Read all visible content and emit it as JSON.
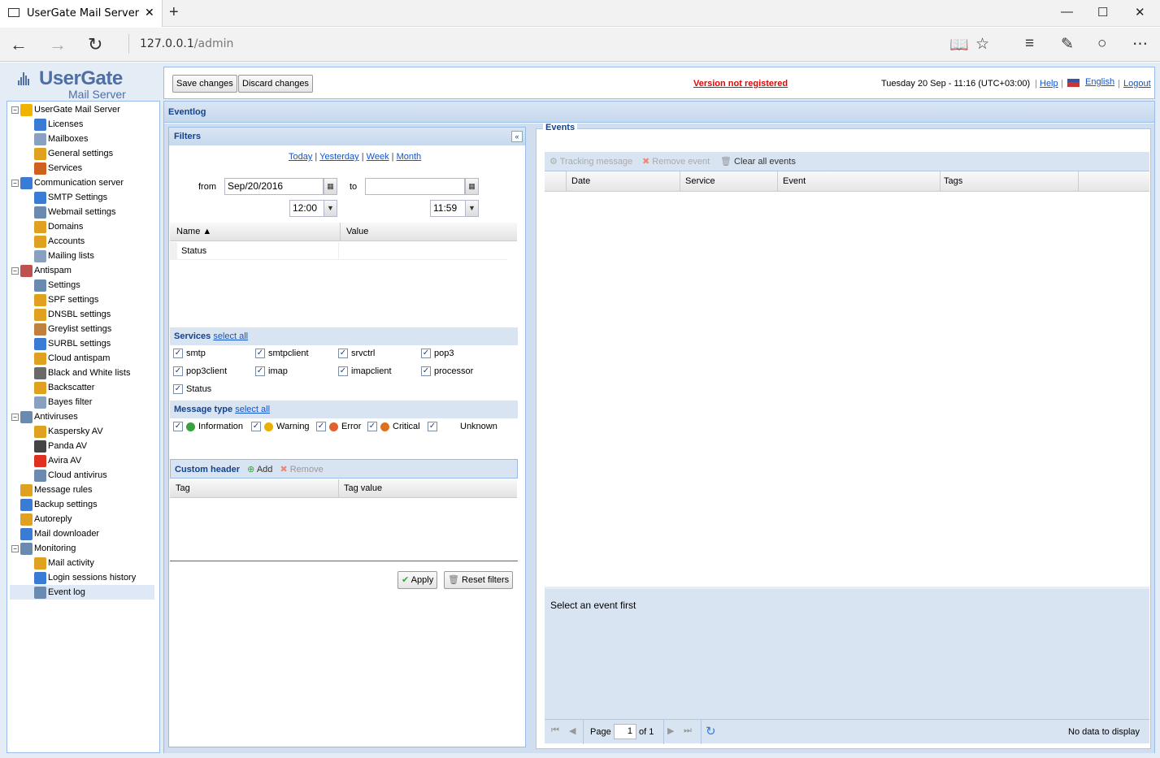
{
  "browser": {
    "tab_title": "UserGate Mail Server",
    "url_host": "127.0.0.1",
    "url_path": "/admin",
    "new_tab": "+",
    "minimize": "—",
    "maximize": "☐",
    "close": "✕"
  },
  "logo": {
    "brand": "UserGate",
    "product": "Mail Server"
  },
  "toolbar": {
    "save_label": "Save changes",
    "discard_label": "Discard changes",
    "not_registered": "Version not registered",
    "datetime": "Tuesday 20 Sep - 11:16 (UTC+03:00)",
    "help": "Help",
    "language": "English",
    "logout": "Logout",
    "sep": "|"
  },
  "tree": {
    "items": [
      {
        "label": "UserGate Mail Server",
        "icon": "server-icon",
        "color": "#f0b400"
      },
      {
        "label": "Licenses",
        "icon": "info-icon",
        "color": "#3a7bd5"
      },
      {
        "label": "Mailboxes",
        "icon": "mailbox-icon",
        "color": "#8aa0c0"
      },
      {
        "label": "General settings",
        "icon": "settings-icon",
        "color": "#e0a020"
      },
      {
        "label": "Services",
        "icon": "gears-icon",
        "color": "#d06020"
      },
      {
        "label": "Communication server",
        "icon": "at-icon",
        "color": "#3a7bd5"
      },
      {
        "label": "SMTP Settings",
        "icon": "at-icon",
        "color": "#3a7bd5"
      },
      {
        "label": "Webmail settings",
        "icon": "web-icon",
        "color": "#6a8ab0"
      },
      {
        "label": "Domains",
        "icon": "home-icon",
        "color": "#e0a020"
      },
      {
        "label": "Accounts",
        "icon": "users-icon",
        "color": "#e0a020"
      },
      {
        "label": "Mailing lists",
        "icon": "list-icon",
        "color": "#8aa0c0"
      },
      {
        "label": "Antispam",
        "icon": "antispam-icon",
        "color": "#c05050"
      },
      {
        "label": "Settings",
        "icon": "tools-icon",
        "color": "#6a8ab0"
      },
      {
        "label": "SPF settings",
        "icon": "spf-icon",
        "color": "#e0a020"
      },
      {
        "label": "DNSBL settings",
        "icon": "globe-icon",
        "color": "#e0a020"
      },
      {
        "label": "Greylist settings",
        "icon": "greylist-icon",
        "color": "#c08040"
      },
      {
        "label": "SURBL settings",
        "icon": "surbl-icon",
        "color": "#3a7bd5"
      },
      {
        "label": "Cloud antispam",
        "icon": "cloud-mail-icon",
        "color": "#e0a020"
      },
      {
        "label": "Black and White lists",
        "icon": "bw-list-icon",
        "color": "#6a6a6a"
      },
      {
        "label": "Backscatter",
        "icon": "backscatter-icon",
        "color": "#e0a020"
      },
      {
        "label": "Bayes filter",
        "icon": "bayes-icon",
        "color": "#8aa0c0"
      },
      {
        "label": "Antiviruses",
        "icon": "antivirus-icon",
        "color": "#6a8ab0"
      },
      {
        "label": "Kaspersky AV",
        "icon": "kaspersky-icon",
        "color": "#e0a020"
      },
      {
        "label": "Panda AV",
        "icon": "panda-icon",
        "color": "#444444"
      },
      {
        "label": "Avira AV",
        "icon": "avira-icon",
        "color": "#e03020"
      },
      {
        "label": "Cloud antivirus",
        "icon": "cloud-av-icon",
        "color": "#6a8ab0"
      },
      {
        "label": "Message rules",
        "icon": "rules-icon",
        "color": "#e0a020"
      },
      {
        "label": "Backup settings",
        "icon": "backup-icon",
        "color": "#3a7bd5"
      },
      {
        "label": "Autoreply",
        "icon": "autoreply-icon",
        "color": "#e0a020"
      },
      {
        "label": "Mail downloader",
        "icon": "downloader-icon",
        "color": "#3a7bd5"
      },
      {
        "label": "Monitoring",
        "icon": "monitoring-icon",
        "color": "#6a8ab0"
      },
      {
        "label": "Mail activity",
        "icon": "activity-icon",
        "color": "#e0a020"
      },
      {
        "label": "Login sessions history",
        "icon": "history-icon",
        "color": "#3a7bd5"
      },
      {
        "label": "Event log",
        "icon": "eventlog-icon",
        "color": "#6a8ab0"
      }
    ]
  },
  "eventlog": {
    "title": "Eventlog"
  },
  "filters": {
    "title": "Filters",
    "collapse": "«",
    "quick": [
      "Today",
      "Yesterday",
      "Week",
      "Month"
    ],
    "from_label": "from",
    "from_date": "Sep/20/2016",
    "to_label": "to",
    "to_date": "",
    "from_time": "12:00",
    "to_time": "11:59",
    "grid_name": "Name ▲",
    "grid_value": "Value",
    "grid_rows": [
      {
        "name": "Status",
        "value": ""
      }
    ],
    "services_title": "Services",
    "select_all": "select all",
    "services": [
      "smtp",
      "smtpclient",
      "srvctrl",
      "pop3",
      "pop3client",
      "imap",
      "imapclient",
      "processor",
      "Status"
    ],
    "msgtype_title": "Message type",
    "msgtypes": [
      {
        "label": "Information",
        "icon": "info-icon",
        "color": "#3aa040"
      },
      {
        "label": "Warning",
        "icon": "warning-icon",
        "color": "#e8b000"
      },
      {
        "label": "Error",
        "icon": "error-icon",
        "color": "#e06030"
      },
      {
        "label": "Critical",
        "icon": "critical-icon",
        "color": "#e07020"
      },
      {
        "label": "Unknown",
        "icon": "",
        "color": ""
      }
    ],
    "custom_title": "Custom header",
    "add": "Add",
    "remove": "Remove",
    "tag_col": "Tag",
    "tagvalue_col": "Tag value",
    "apply": "Apply",
    "reset": "Reset filters"
  },
  "events": {
    "title": "Events",
    "tracking": "Tracking message",
    "remove_event": "Remove event",
    "clear_all": "Clear all events",
    "cols": [
      "Date",
      "Service",
      "Event",
      "Tags"
    ],
    "detail": "Select an event first",
    "page_label": "Page",
    "page_num": "1",
    "of_label": "of 1",
    "no_data": "No data to display"
  }
}
